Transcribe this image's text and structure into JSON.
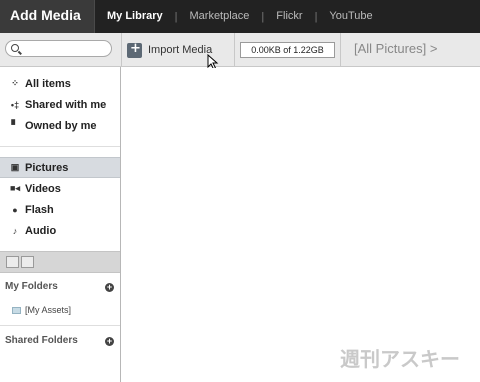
{
  "app": {
    "title": "Add Media"
  },
  "nav": {
    "tabs": [
      "My Library",
      "Marketplace",
      "Flickr",
      "YouTube"
    ],
    "active": "My Library"
  },
  "toolbar": {
    "search_value": "",
    "import_label": "Import Media",
    "storage_text": "0.00KB of 1.22GB",
    "breadcrumb": "[All Pictures] >"
  },
  "sidebar": {
    "filters": [
      {
        "label": "All items",
        "icon": "all-items-icon"
      },
      {
        "label": "Shared with me",
        "icon": "shared-icon"
      },
      {
        "label": "Owned by me",
        "icon": "owner-icon"
      }
    ],
    "types": [
      {
        "label": "Pictures",
        "icon": "picture-icon",
        "selected": true
      },
      {
        "label": "Videos",
        "icon": "video-camera-icon"
      },
      {
        "label": "Flash",
        "icon": "flash-icon"
      },
      {
        "label": "Audio",
        "icon": "music-note-icon"
      }
    ],
    "my_folders": {
      "title": "My Folders",
      "items": [
        "[My Assets]"
      ]
    },
    "shared_folders": {
      "title": "Shared Folders"
    }
  },
  "watermark": "週刊アスキー",
  "colors": {
    "topbar": "#222222",
    "selected_row": "#d7dbe0",
    "toolbar": "#e9e9e9"
  }
}
